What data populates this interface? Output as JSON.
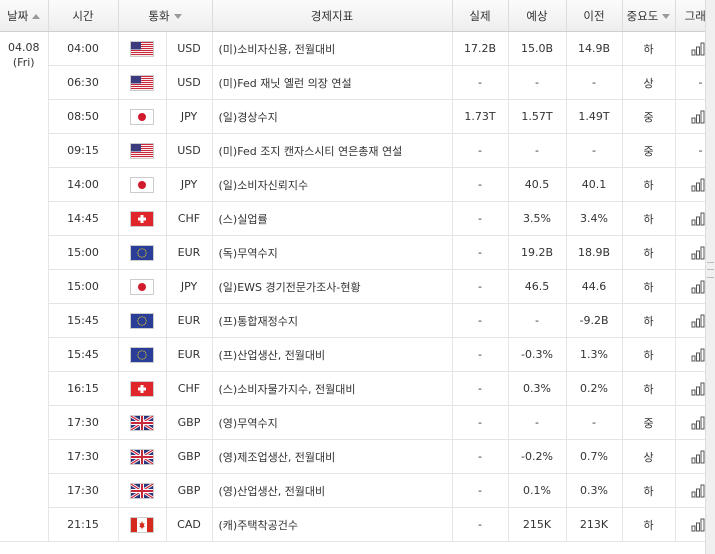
{
  "headers": {
    "date": "날짜",
    "time": "시간",
    "currency": "통화",
    "indicator": "경제지표",
    "actual": "실제",
    "forecast": "예상",
    "previous": "이전",
    "importance": "중요도",
    "graph": "그래프"
  },
  "date_cell": {
    "date": "04.08",
    "day": "(Fri)"
  },
  "rows": [
    {
      "time": "04:00",
      "flag": "us",
      "currency": "USD",
      "indicator": "(미)소비자신용, 전월대비",
      "actual": "17.2B",
      "forecast": "15.0B",
      "previous": "14.9B",
      "importance": "하",
      "graph": "chart-icon"
    },
    {
      "time": "06:30",
      "flag": "us",
      "currency": "USD",
      "indicator": "(미)Fed 재닛 옐런 의장 연설",
      "actual": "-",
      "forecast": "-",
      "previous": "-",
      "importance": "상",
      "graph": "-"
    },
    {
      "time": "08:50",
      "flag": "jp",
      "currency": "JPY",
      "indicator": "(일)경상수지",
      "actual": "1.73T",
      "forecast": "1.57T",
      "previous": "1.49T",
      "importance": "중",
      "graph": "chart-icon"
    },
    {
      "time": "09:15",
      "flag": "us",
      "currency": "USD",
      "indicator": "(미)Fed 조지 캔자스시티 연은총재 연설",
      "actual": "-",
      "forecast": "-",
      "previous": "-",
      "importance": "중",
      "graph": "-"
    },
    {
      "time": "14:00",
      "flag": "jp",
      "currency": "JPY",
      "indicator": "(일)소비자신뢰지수",
      "actual": "-",
      "forecast": "40.5",
      "previous": "40.1",
      "importance": "하",
      "graph": "chart-icon"
    },
    {
      "time": "14:45",
      "flag": "ch",
      "currency": "CHF",
      "indicator": "(스)실업률",
      "actual": "-",
      "forecast": "3.5%",
      "previous": "3.4%",
      "importance": "하",
      "graph": "chart-icon"
    },
    {
      "time": "15:00",
      "flag": "eu",
      "currency": "EUR",
      "indicator": "(독)무역수지",
      "actual": "-",
      "forecast": "19.2B",
      "previous": "18.9B",
      "importance": "하",
      "graph": "chart-icon"
    },
    {
      "time": "15:00",
      "flag": "jp",
      "currency": "JPY",
      "indicator": "(일)EWS 경기전문가조사-현황",
      "actual": "-",
      "forecast": "46.5",
      "previous": "44.6",
      "importance": "하",
      "graph": "chart-icon"
    },
    {
      "time": "15:45",
      "flag": "eu",
      "currency": "EUR",
      "indicator": "(프)통합재정수지",
      "actual": "-",
      "forecast": "-",
      "previous": "-9.2B",
      "importance": "하",
      "graph": "chart-icon"
    },
    {
      "time": "15:45",
      "flag": "eu",
      "currency": "EUR",
      "indicator": "(프)산업생산, 전월대비",
      "actual": "-",
      "forecast": "-0.3%",
      "previous": "1.3%",
      "importance": "하",
      "graph": "chart-icon"
    },
    {
      "time": "16:15",
      "flag": "ch",
      "currency": "CHF",
      "indicator": "(스)소비자물가지수, 전월대비",
      "actual": "-",
      "forecast": "0.3%",
      "previous": "0.2%",
      "importance": "하",
      "graph": "chart-icon"
    },
    {
      "time": "17:30",
      "flag": "gb",
      "currency": "GBP",
      "indicator": "(영)무역수지",
      "actual": "-",
      "forecast": "-",
      "previous": "-",
      "importance": "중",
      "graph": "chart-icon"
    },
    {
      "time": "17:30",
      "flag": "gb",
      "currency": "GBP",
      "indicator": "(영)제조업생산, 전월대비",
      "actual": "-",
      "forecast": "-0.2%",
      "previous": "0.7%",
      "importance": "상",
      "graph": "chart-icon"
    },
    {
      "time": "17:30",
      "flag": "gb",
      "currency": "GBP",
      "indicator": "(영)산업생산, 전월대비",
      "actual": "-",
      "forecast": "0.1%",
      "previous": "0.3%",
      "importance": "하",
      "graph": "chart-icon"
    },
    {
      "time": "21:15",
      "flag": "ca",
      "currency": "CAD",
      "indicator": "(캐)주택착공건수",
      "actual": "-",
      "forecast": "215K",
      "previous": "213K",
      "importance": "하",
      "graph": "chart-icon"
    }
  ]
}
